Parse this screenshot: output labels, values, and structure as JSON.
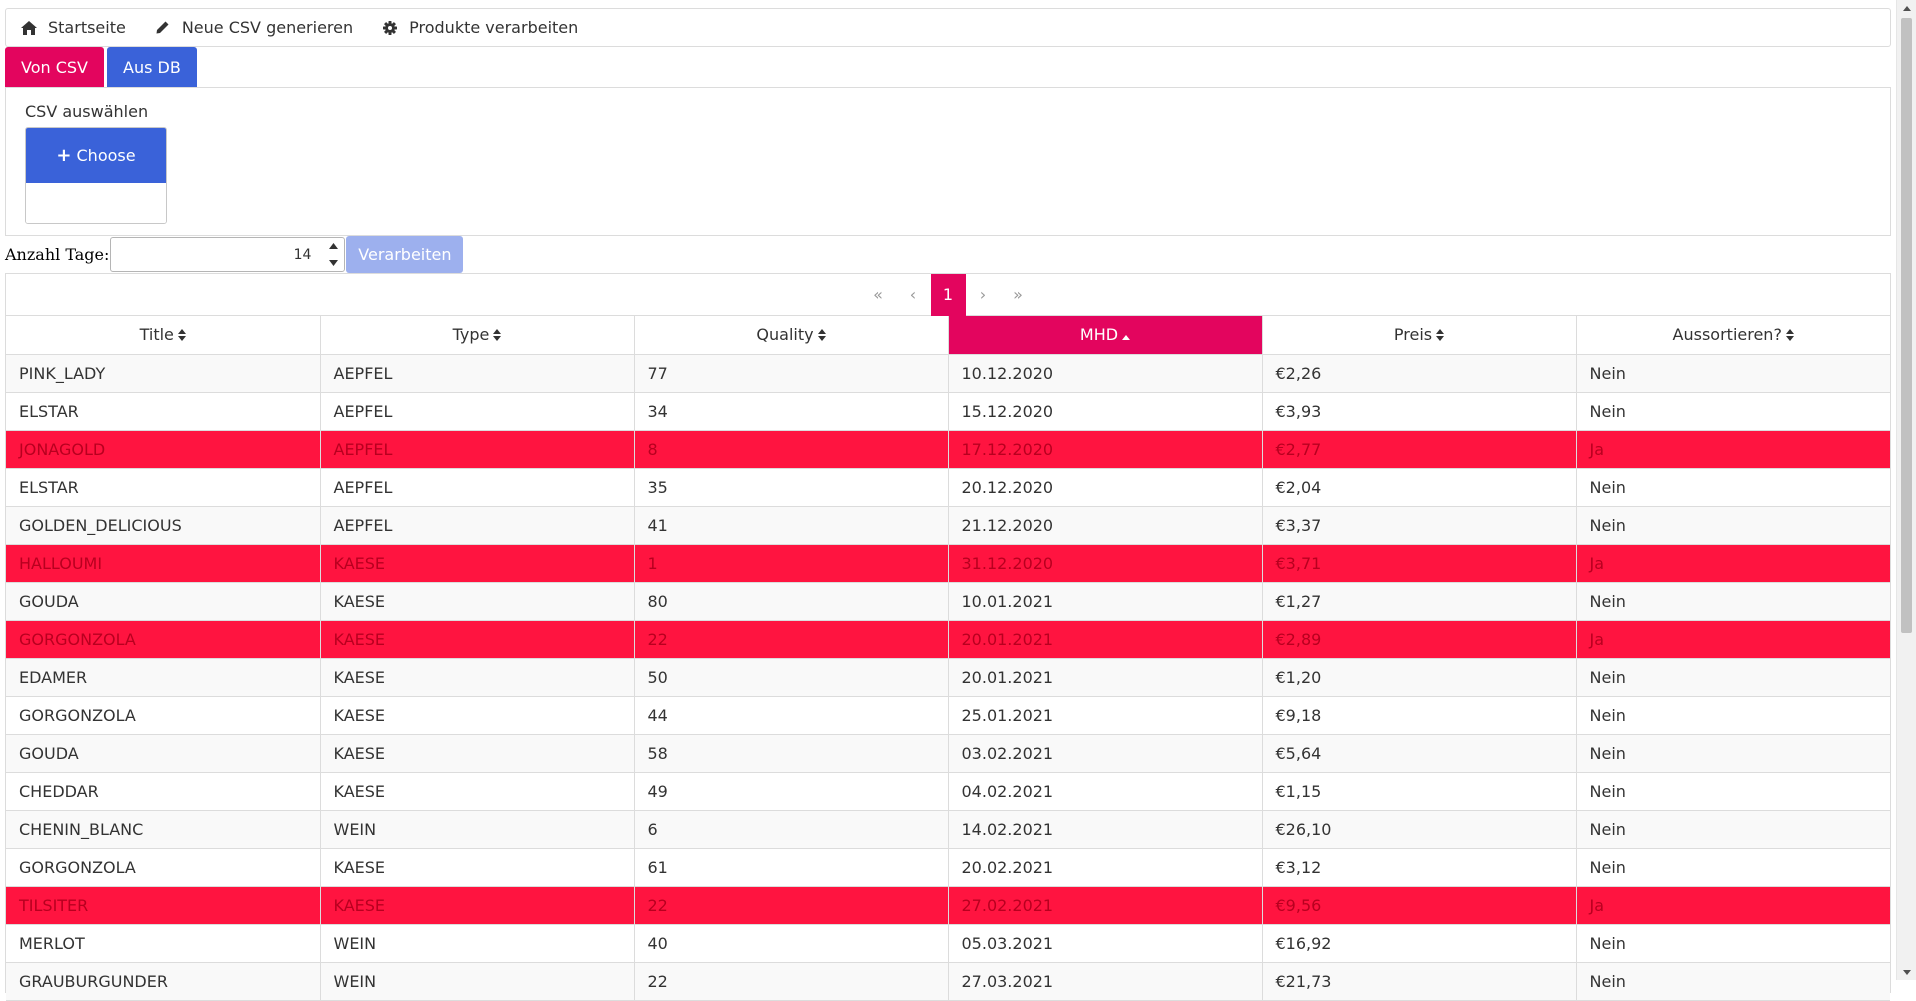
{
  "menu": {
    "items": [
      {
        "label": "Startseite",
        "icon": "home-icon"
      },
      {
        "label": "Neue CSV generieren",
        "icon": "pencil-icon"
      },
      {
        "label": "Produkte verarbeiten",
        "icon": "gear-icon"
      }
    ]
  },
  "tabs": {
    "csv": "Von CSV",
    "db": "Aus DB"
  },
  "upload": {
    "label": "CSV auswählen",
    "choose_label": "Choose",
    "choose_icon": "plus-icon"
  },
  "controls": {
    "days_label": "Anzahl Tage:",
    "days_value": "14",
    "process_label": "Verarbeiten"
  },
  "pager": {
    "first": "«",
    "prev": "‹",
    "current": "1",
    "next": "›",
    "last": "»"
  },
  "table": {
    "columns": [
      "Title",
      "Type",
      "Quality",
      "MHD",
      "Preis",
      "Aussortieren?"
    ],
    "sorted_column": "MHD",
    "sort_direction": "asc",
    "rows": [
      {
        "cells": [
          "PINK_LADY",
          "AEPFEL",
          "77",
          "10.12.2020",
          "€2,26",
          "Nein"
        ],
        "highlight": false
      },
      {
        "cells": [
          "ELSTAR",
          "AEPFEL",
          "34",
          "15.12.2020",
          "€3,93",
          "Nein"
        ],
        "highlight": false
      },
      {
        "cells": [
          "JONAGOLD",
          "AEPFEL",
          "8",
          "17.12.2020",
          "€2,77",
          "Ja"
        ],
        "highlight": true
      },
      {
        "cells": [
          "ELSTAR",
          "AEPFEL",
          "35",
          "20.12.2020",
          "€2,04",
          "Nein"
        ],
        "highlight": false
      },
      {
        "cells": [
          "GOLDEN_DELICIOUS",
          "AEPFEL",
          "41",
          "21.12.2020",
          "€3,37",
          "Nein"
        ],
        "highlight": false
      },
      {
        "cells": [
          "HALLOUMI",
          "KAESE",
          "1",
          "31.12.2020",
          "€3,71",
          "Ja"
        ],
        "highlight": true
      },
      {
        "cells": [
          "GOUDA",
          "KAESE",
          "80",
          "10.01.2021",
          "€1,27",
          "Nein"
        ],
        "highlight": false
      },
      {
        "cells": [
          "GORGONZOLA",
          "KAESE",
          "22",
          "20.01.2021",
          "€2,89",
          "Ja"
        ],
        "highlight": true
      },
      {
        "cells": [
          "EDAMER",
          "KAESE",
          "50",
          "20.01.2021",
          "€1,20",
          "Nein"
        ],
        "highlight": false
      },
      {
        "cells": [
          "GORGONZOLA",
          "KAESE",
          "44",
          "25.01.2021",
          "€9,18",
          "Nein"
        ],
        "highlight": false
      },
      {
        "cells": [
          "GOUDA",
          "KAESE",
          "58",
          "03.02.2021",
          "€5,64",
          "Nein"
        ],
        "highlight": false
      },
      {
        "cells": [
          "CHEDDAR",
          "KAESE",
          "49",
          "04.02.2021",
          "€1,15",
          "Nein"
        ],
        "highlight": false
      },
      {
        "cells": [
          "CHENIN_BLANC",
          "WEIN",
          "6",
          "14.02.2021",
          "€26,10",
          "Nein"
        ],
        "highlight": false
      },
      {
        "cells": [
          "GORGONZOLA",
          "KAESE",
          "61",
          "20.02.2021",
          "€3,12",
          "Nein"
        ],
        "highlight": false
      },
      {
        "cells": [
          "TILSITER",
          "KAESE",
          "22",
          "27.02.2021",
          "€9,56",
          "Ja"
        ],
        "highlight": true
      },
      {
        "cells": [
          "MERLOT",
          "WEIN",
          "40",
          "05.03.2021",
          "€16,92",
          "Nein"
        ],
        "highlight": false
      },
      {
        "cells": [
          "GRAUBURGUNDER",
          "WEIN",
          "22",
          "27.03.2021",
          "€21,73",
          "Nein"
        ],
        "highlight": false
      }
    ]
  },
  "colors": {
    "accent_pink": "#e3055e",
    "accent_blue": "#3a62d9",
    "highlight_row": "#ff1440",
    "disabled_button": "#9db0ee"
  }
}
